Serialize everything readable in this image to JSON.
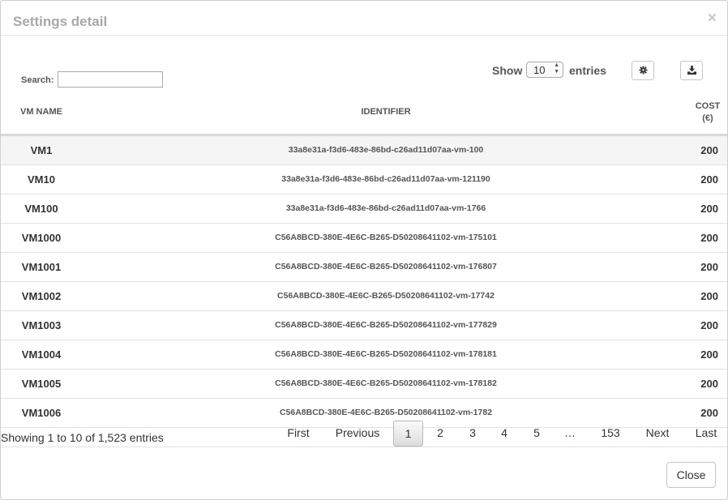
{
  "modal": {
    "title": "Settings detail",
    "close_glyph": "×"
  },
  "toolbar": {
    "search_label": "Search:",
    "search_value": "",
    "show_label": "Show",
    "page_size": "10",
    "entries_label": "entries",
    "settings_icon": "gear-icon",
    "download_icon": "download-icon"
  },
  "table": {
    "headers": {
      "name": "VM NAME",
      "identifier": "IDENTIFIER",
      "cost": "COST (€)"
    },
    "rows": [
      {
        "name": "VM1",
        "identifier": "33a8e31a-f3d6-483e-86bd-c26ad11d07aa-vm-100",
        "cost": "200"
      },
      {
        "name": "VM10",
        "identifier": "33a8e31a-f3d6-483e-86bd-c26ad11d07aa-vm-121190",
        "cost": "200"
      },
      {
        "name": "VM100",
        "identifier": "33a8e31a-f3d6-483e-86bd-c26ad11d07aa-vm-1766",
        "cost": "200"
      },
      {
        "name": "VM1000",
        "identifier": "C56A8BCD-380E-4E6C-B265-D50208641102-vm-175101",
        "cost": "200"
      },
      {
        "name": "VM1001",
        "identifier": "C56A8BCD-380E-4E6C-B265-D50208641102-vm-176807",
        "cost": "200"
      },
      {
        "name": "VM1002",
        "identifier": "C56A8BCD-380E-4E6C-B265-D50208641102-vm-17742",
        "cost": "200"
      },
      {
        "name": "VM1003",
        "identifier": "C56A8BCD-380E-4E6C-B265-D50208641102-vm-177829",
        "cost": "200"
      },
      {
        "name": "VM1004",
        "identifier": "C56A8BCD-380E-4E6C-B265-D50208641102-vm-178181",
        "cost": "200"
      },
      {
        "name": "VM1005",
        "identifier": "C56A8BCD-380E-4E6C-B265-D50208641102-vm-178182",
        "cost": "200"
      },
      {
        "name": "VM1006",
        "identifier": "C56A8BCD-380E-4E6C-B265-D50208641102-vm-1782",
        "cost": "200"
      }
    ]
  },
  "info": "Showing 1 to 10 of 1,523 entries",
  "pagination": {
    "first": "First",
    "previous": "Previous",
    "pages": [
      "1",
      "2",
      "3",
      "4",
      "5"
    ],
    "current": "1",
    "ellipsis": "…",
    "last_page": "153",
    "next": "Next",
    "last": "Last"
  },
  "footer": {
    "close_label": "Close"
  }
}
